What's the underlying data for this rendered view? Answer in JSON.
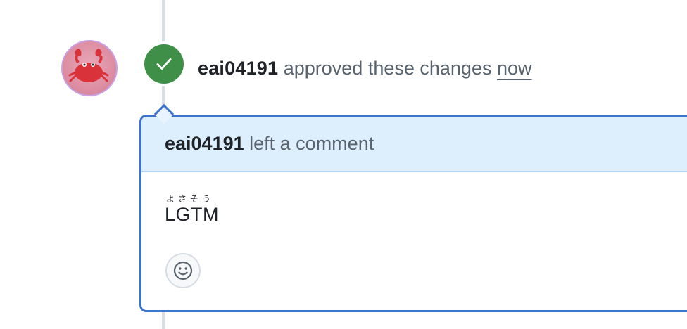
{
  "timeline_event": {
    "author": "eai04191",
    "action": "approved these changes",
    "time": "now",
    "status_color": "#3f8f48"
  },
  "review_comment": {
    "header_author": "eai04191",
    "header_action": "left a comment",
    "ruby": "よさそう",
    "body": "LGTM",
    "reaction_icon": "smiley-icon",
    "accent_color": "#3b73cf"
  }
}
